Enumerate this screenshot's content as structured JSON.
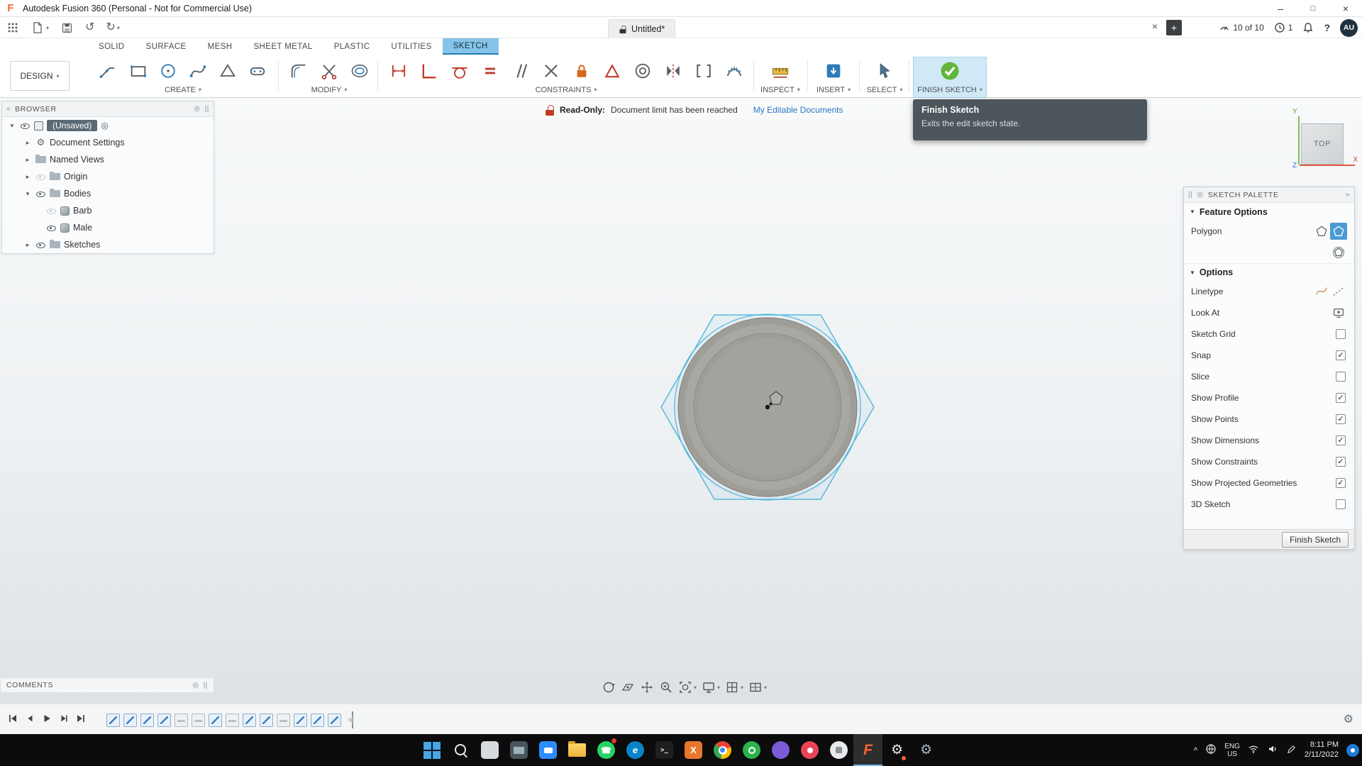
{
  "app": {
    "title": "Autodesk Fusion 360 (Personal - Not for Commercial Use)",
    "logo": "F"
  },
  "icons": {
    "caret": "▾",
    "minimize": "–",
    "maximize": "□",
    "close": "×",
    "tab_close": "×",
    "new_tab": "+",
    "undo": "↺",
    "redo": "↻",
    "back": "«",
    "forward": "»",
    "handle": "||",
    "target": "◎",
    "check": "✓",
    "collapsed": "▸",
    "expanded": "▾",
    "section": "▼",
    "help": "?",
    "tray_caret": "^",
    "phone": "☎",
    "gear": "⚙",
    "terminal": "&gt;_",
    "letter_x": "X",
    "letter_e": "e"
  },
  "document": {
    "tab": "Untitled*"
  },
  "header": {
    "jobs": "10 of 10",
    "notifications": "1",
    "avatar": "AU"
  },
  "ribbon": {
    "workspace": "DESIGN",
    "active_tab": "SKETCH",
    "tabs": [
      {
        "label": "SOLID"
      },
      {
        "label": "SURFACE"
      },
      {
        "label": "MESH"
      },
      {
        "label": "SHEET METAL"
      },
      {
        "label": "PLASTIC"
      },
      {
        "label": "UTILITIES"
      },
      {
        "label": "SKETCH"
      }
    ],
    "groups": [
      {
        "label": "CREATE"
      },
      {
        "label": "MODIFY"
      },
      {
        "label": "CONSTRAINTS"
      },
      {
        "label": "INSPECT"
      },
      {
        "label": "INSERT"
      },
      {
        "label": "SELECT"
      },
      {
        "label": "FINISH SKETCH"
      }
    ]
  },
  "banner": {
    "label": "Read-Only:",
    "message": "Document limit has been reached",
    "link": "My Editable Documents"
  },
  "tooltip": {
    "title": "Finish Sketch",
    "body": "Exits the edit sketch state."
  },
  "browser": {
    "title": "BROWSER",
    "items": [
      {
        "label": "(Unsaved)"
      },
      {
        "label": "Document Settings"
      },
      {
        "label": "Named Views"
      },
      {
        "label": "Origin"
      },
      {
        "label": "Bodies"
      },
      {
        "label": "Barb"
      },
      {
        "label": "Male"
      },
      {
        "label": "Sketches"
      }
    ]
  },
  "viewcube": {
    "face": "TOP",
    "axis_x": "X",
    "axis_y": "Y",
    "axis_z": "Z"
  },
  "palette": {
    "title": "SKETCH PALETTE",
    "feature_section": "Feature Options",
    "polygon_label": "Polygon",
    "options_section": "Options",
    "options": [
      {
        "label": "Linetype"
      },
      {
        "label": "Look At"
      },
      {
        "label": "Sketch Grid",
        "mark": ""
      },
      {
        "label": "Snap",
        "mark": "✓"
      },
      {
        "label": "Slice",
        "mark": ""
      },
      {
        "label": "Show Profile",
        "mark": "✓"
      },
      {
        "label": "Show Points",
        "mark": "✓"
      },
      {
        "label": "Show Dimensions",
        "mark": "✓"
      },
      {
        "label": "Show Constraints",
        "mark": "✓"
      },
      {
        "label": "Show Projected Geometries",
        "mark": "✓"
      },
      {
        "label": "3D Sketch",
        "mark": ""
      }
    ],
    "finish_button": "Finish Sketch"
  },
  "comments": {
    "title": "COMMENTS"
  },
  "canvas": {
    "view": "TOP",
    "body_color": "#a3a29d",
    "sketch_color": "#55b9dc"
  },
  "timeline": {
    "features": [
      "sketch",
      "sketch",
      "sketch",
      "sketch",
      "plane",
      "plane",
      "sketch",
      "plane",
      "sketch",
      "sketch",
      "plane",
      "sketch",
      "sketch",
      "sketch"
    ]
  },
  "taskbar": {
    "apps": [
      "start",
      "search",
      "snip",
      "monitor",
      "zoom",
      "explorer",
      "whatsapp",
      "edge",
      "terminal",
      "x-app",
      "chrome",
      "green-app",
      "purple-app",
      "red-app",
      "white-app",
      "fusion-360",
      "settings",
      "tools"
    ],
    "tray": {
      "lang_top": "ENG",
      "lang_bottom": "US",
      "time": "8:11 PM",
      "date": "2/11/2022"
    }
  }
}
